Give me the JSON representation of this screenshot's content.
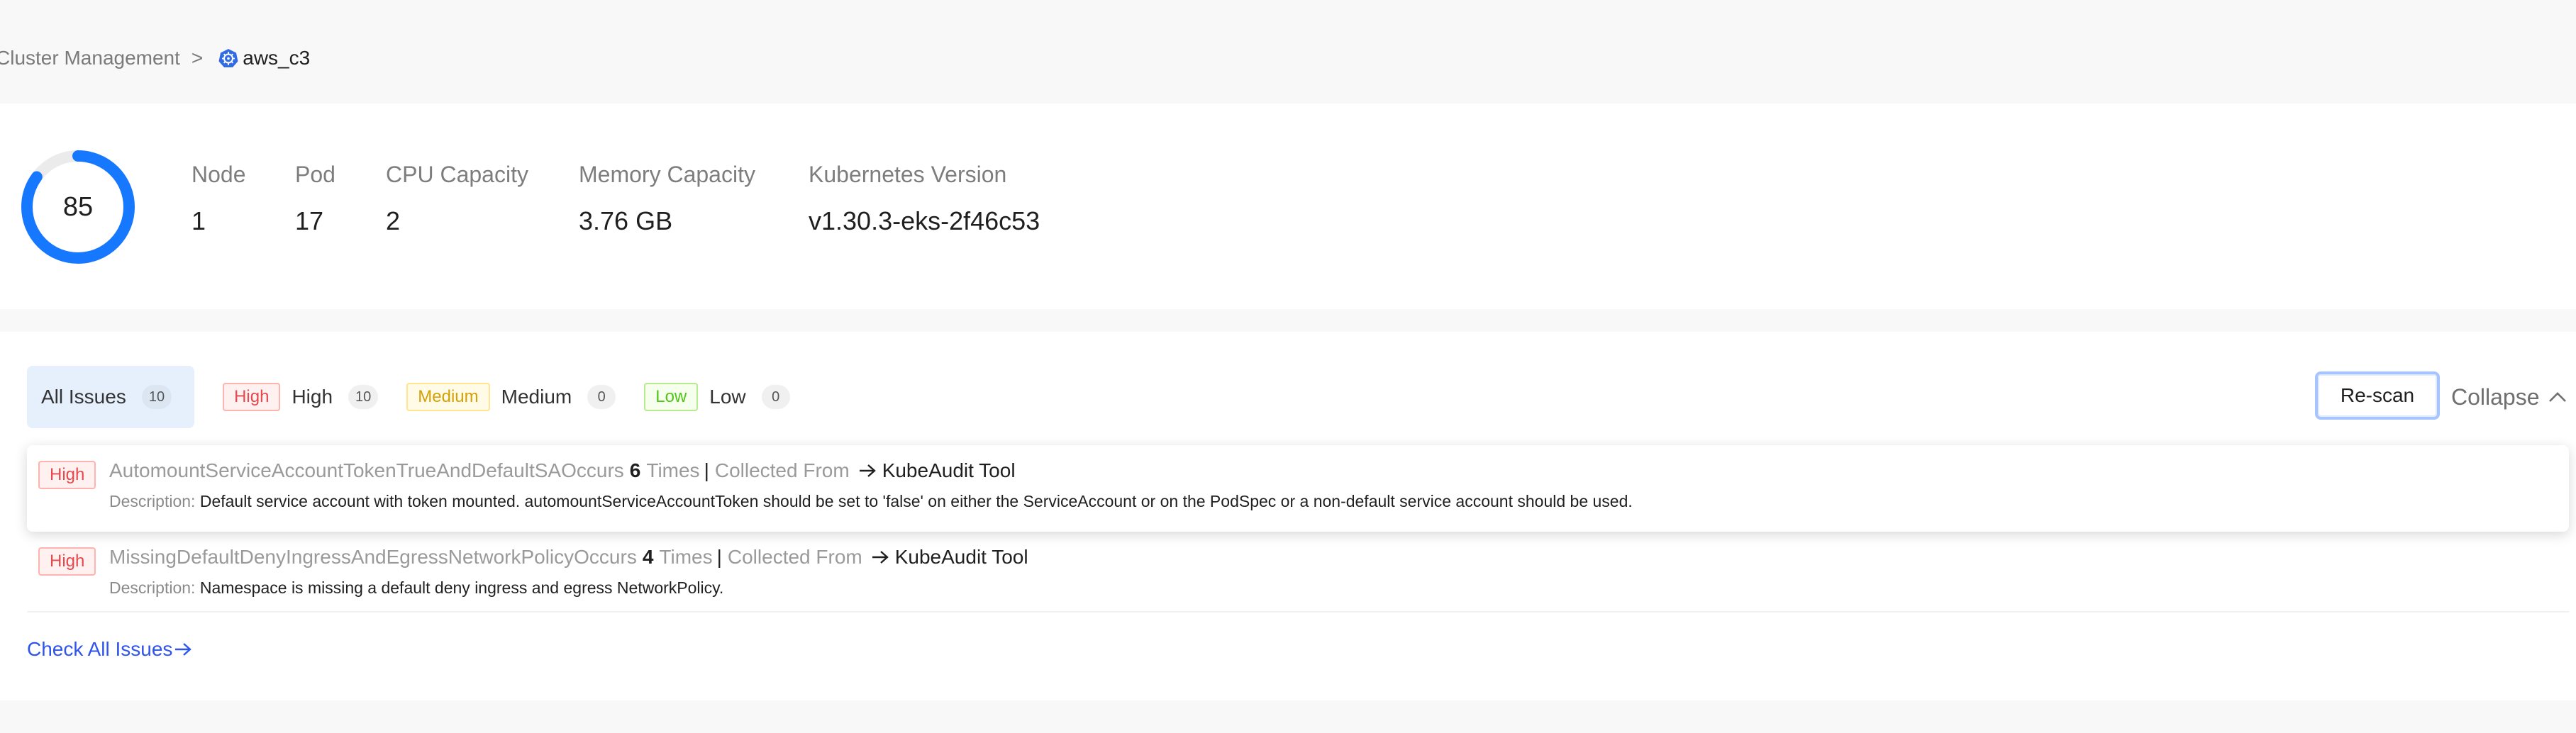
{
  "breadcrumb": {
    "parent": "Cluster Management",
    "separator": ">",
    "current": "aws_c3",
    "icon": "kubernetes-icon"
  },
  "summary": {
    "score": "85",
    "score_fraction": 0.85,
    "stats": [
      {
        "label": "Node",
        "value": "1"
      },
      {
        "label": "Pod",
        "value": "17"
      },
      {
        "label": "CPU Capacity",
        "value": "2"
      },
      {
        "label": "Memory Capacity",
        "value": "3.76 GB"
      },
      {
        "label": "Kubernetes Version",
        "value": "v1.30.3-eks-2f46c53"
      }
    ]
  },
  "filters": {
    "all": {
      "label": "All Issues",
      "count": "10"
    },
    "high": {
      "tag": "High",
      "label": "High",
      "count": "10"
    },
    "medium": {
      "tag": "Medium",
      "label": "Medium",
      "count": "0"
    },
    "low": {
      "tag": "Low",
      "label": "Low",
      "count": "0"
    }
  },
  "actions": {
    "rescan": "Re-scan",
    "collapse": "Collapse"
  },
  "issues": [
    {
      "severity": "High",
      "name": "AutomountServiceAccountTokenTrueAndDefaultSA",
      "occurs": "Occurs",
      "times": "6",
      "times_label": "Times",
      "pipe": "|",
      "collected_from": "Collected From",
      "tool": "KubeAudit Tool",
      "description_label": "Description:",
      "description": "Default service account with token mounted. automountServiceAccountToken should be set to 'false' on either the ServiceAccount or on the PodSpec or a non-default service account should be used."
    },
    {
      "severity": "High",
      "name": "MissingDefaultDenyIngressAndEgressNetworkPolicy",
      "occurs": "Occurs",
      "times": "4",
      "times_label": "Times",
      "pipe": "|",
      "collected_from": "Collected From",
      "tool": "KubeAudit Tool",
      "description_label": "Description:",
      "description": "Namespace is missing a default deny ingress and egress NetworkPolicy."
    }
  ],
  "check_all": "Check All Issues",
  "colors": {
    "accent": "#1677ff",
    "link": "#2f54eb",
    "high": "#e5484d",
    "medium": "#d4a106",
    "low": "#52c41a"
  }
}
